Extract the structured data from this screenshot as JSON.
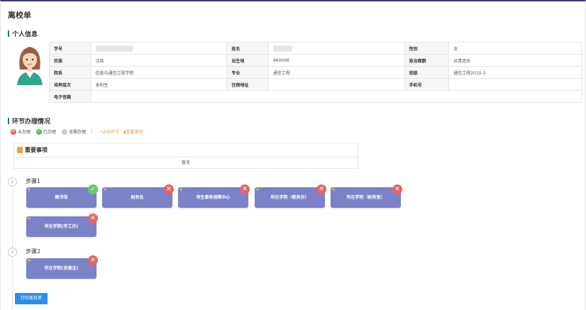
{
  "page_title": "离校单",
  "personal_section": "个人信息",
  "info_rows": [
    [
      {
        "k": "学号",
        "v": "",
        "blur": true
      },
      {
        "k": "姓名",
        "v": "",
        "blur": true,
        "short": true
      },
      {
        "k": "性别",
        "v": "女"
      }
    ],
    [
      {
        "k": "民族",
        "v": "汉族"
      },
      {
        "k": "出生地",
        "v": "460006"
      },
      {
        "k": "政治面貌",
        "v": "共青团员"
      }
    ],
    [
      {
        "k": "院系",
        "v": "信息与通信工程学院"
      },
      {
        "k": "专业",
        "v": "通信工程"
      },
      {
        "k": "班级",
        "v": "通信工程2010-3"
      }
    ],
    [
      {
        "k": "培养层次",
        "v": "本科生"
      },
      {
        "k": "住宿地址",
        "v": ""
      },
      {
        "k": "手机号",
        "v": ""
      }
    ],
    [
      {
        "k": "电子信箱",
        "v": ""
      }
    ]
  ],
  "process_section": "环节办理情况",
  "legend": {
    "pending": "未办理",
    "done": "已办理",
    "no_need": "无需办理",
    "sep": "|",
    "required": "*必办环节",
    "important": "重要事项"
  },
  "important": {
    "title": "重要事项",
    "body": "暂无"
  },
  "steps": [
    {
      "num": "1",
      "label": "步骤1"
    },
    {
      "num": "2",
      "label": "步骤2"
    }
  ],
  "cards": {
    "library": {
      "label": "图书馆",
      "status": "ok"
    },
    "finance": {
      "label": "财务处",
      "status": "no"
    },
    "service": {
      "label": "师生事务保障中心",
      "status": "no"
    },
    "academic": {
      "label": "所在学院（教务办）",
      "status": "no"
    },
    "finance_office": {
      "label": "所在学院（财务室）",
      "status": "no"
    },
    "student_affairs": {
      "label": "所在学院(学工办)",
      "status": "no"
    },
    "certificate": {
      "label": "所在学院(发离证)",
      "status": "no"
    }
  },
  "star": "*",
  "icons": {
    "ok": "✓",
    "no": "✕"
  },
  "print_button": "打印离校单",
  "colors": {
    "card": "#7b82c8",
    "ok": "#5fcf68",
    "no": "#e46565",
    "button": "#2d8ee8",
    "accent": "#3565a8"
  }
}
